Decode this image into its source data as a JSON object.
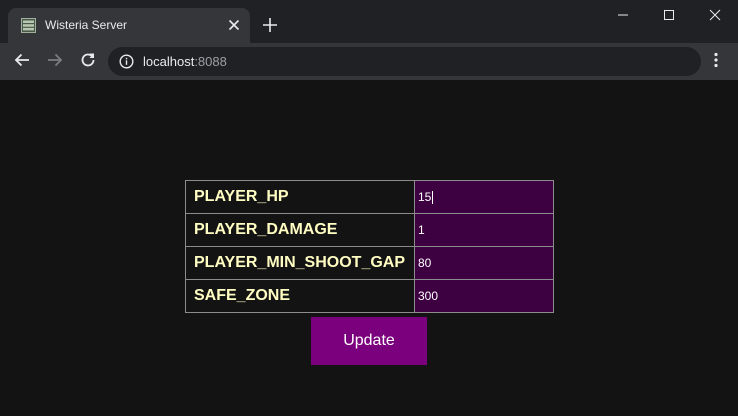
{
  "browser": {
    "tab_title": "Wisteria Server",
    "url_host": "localhost",
    "url_port": ":8088"
  },
  "colors": {
    "key_text": "#fffdc2",
    "value_cell_bg": "#3d0040",
    "button_bg": "#7b007d",
    "page_bg": "#131313"
  },
  "config": {
    "rows": [
      {
        "key": "PLAYER_HP",
        "value": "15"
      },
      {
        "key": "PLAYER_DAMAGE",
        "value": "1"
      },
      {
        "key": "PLAYER_MIN_SHOOT_GAP",
        "value": "80"
      },
      {
        "key": "SAFE_ZONE",
        "value": "300"
      }
    ]
  },
  "update_button": {
    "label": "Update"
  },
  "icons": {
    "favicon": "server-icon",
    "tab_close": "close-icon",
    "new_tab": "plus-icon",
    "back": "arrow-left-icon",
    "forward": "arrow-right-icon",
    "reload": "reload-icon",
    "site_info": "info-icon",
    "menu": "more-vertical-icon"
  }
}
